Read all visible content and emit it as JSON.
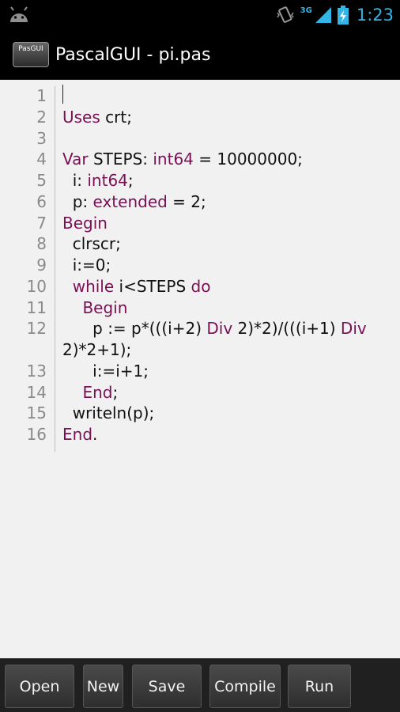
{
  "status_bar": {
    "network": "3G",
    "time": "1:23",
    "icons": [
      "android-icon",
      "vibrate-icon",
      "signal-icon",
      "battery-charging-icon"
    ]
  },
  "action_bar": {
    "app_icon_label": "PasGUI",
    "title": "PascalGUI - pi.pas"
  },
  "editor": {
    "lines": [
      {
        "n": "1",
        "segs": [
          {
            "t": "",
            "k": false
          }
        ]
      },
      {
        "n": "2",
        "segs": [
          {
            "t": "Uses",
            "k": true
          },
          {
            "t": " crt;",
            "k": false
          }
        ]
      },
      {
        "n": "3",
        "segs": [
          {
            "t": "",
            "k": false
          }
        ]
      },
      {
        "n": "4",
        "segs": [
          {
            "t": "Var",
            "k": true
          },
          {
            "t": " STEPS: ",
            "k": false
          },
          {
            "t": "int64",
            "k": true
          },
          {
            "t": " = 10000000;",
            "k": false
          }
        ]
      },
      {
        "n": "5",
        "segs": [
          {
            "t": "  i: ",
            "k": false
          },
          {
            "t": "int64",
            "k": true
          },
          {
            "t": ";",
            "k": false
          }
        ]
      },
      {
        "n": "6",
        "segs": [
          {
            "t": "  p: ",
            "k": false
          },
          {
            "t": "extended",
            "k": true
          },
          {
            "t": " = 2;",
            "k": false
          }
        ]
      },
      {
        "n": "7",
        "segs": [
          {
            "t": "Begin",
            "k": true
          }
        ]
      },
      {
        "n": "8",
        "segs": [
          {
            "t": "  clrscr;",
            "k": false
          }
        ]
      },
      {
        "n": "9",
        "segs": [
          {
            "t": "  i:=0;",
            "k": false
          }
        ]
      },
      {
        "n": "10",
        "segs": [
          {
            "t": "  ",
            "k": false
          },
          {
            "t": "while",
            "k": true
          },
          {
            "t": " i<STEPS ",
            "k": false
          },
          {
            "t": "do",
            "k": true
          }
        ]
      },
      {
        "n": "11",
        "segs": [
          {
            "t": "    ",
            "k": false
          },
          {
            "t": "Begin",
            "k": true
          }
        ]
      },
      {
        "n": "12",
        "segs": [
          {
            "t": "      p := p*(((i+2) ",
            "k": false
          },
          {
            "t": "Div",
            "k": true
          },
          {
            "t": " 2)*2)/(((i+1) ",
            "k": false
          },
          {
            "t": "Div",
            "k": true
          }
        ]
      },
      {
        "n": "",
        "segs": [
          {
            "t": "2)*2+1);",
            "k": false
          }
        ]
      },
      {
        "n": "13",
        "segs": [
          {
            "t": "      i:=i+1;",
            "k": false
          }
        ]
      },
      {
        "n": "14",
        "segs": [
          {
            "t": "    ",
            "k": false
          },
          {
            "t": "End",
            "k": true
          },
          {
            "t": ";",
            "k": false
          }
        ]
      },
      {
        "n": "15",
        "segs": [
          {
            "t": "  writeln(p);",
            "k": false
          }
        ]
      },
      {
        "n": "16",
        "segs": [
          {
            "t": "End",
            "k": true
          },
          {
            "t": ".",
            "k": false
          }
        ]
      }
    ]
  },
  "toolbar": {
    "buttons": [
      {
        "id": "open",
        "label": "Open"
      },
      {
        "id": "new",
        "label": "New"
      },
      {
        "id": "save",
        "label": "Save"
      },
      {
        "id": "compile",
        "label": "Compile"
      },
      {
        "id": "run",
        "label": "Run"
      }
    ]
  },
  "colors": {
    "keyword": "#7a1054",
    "status_accent": "#33b5e5",
    "line_number": "#8a8a8a"
  }
}
